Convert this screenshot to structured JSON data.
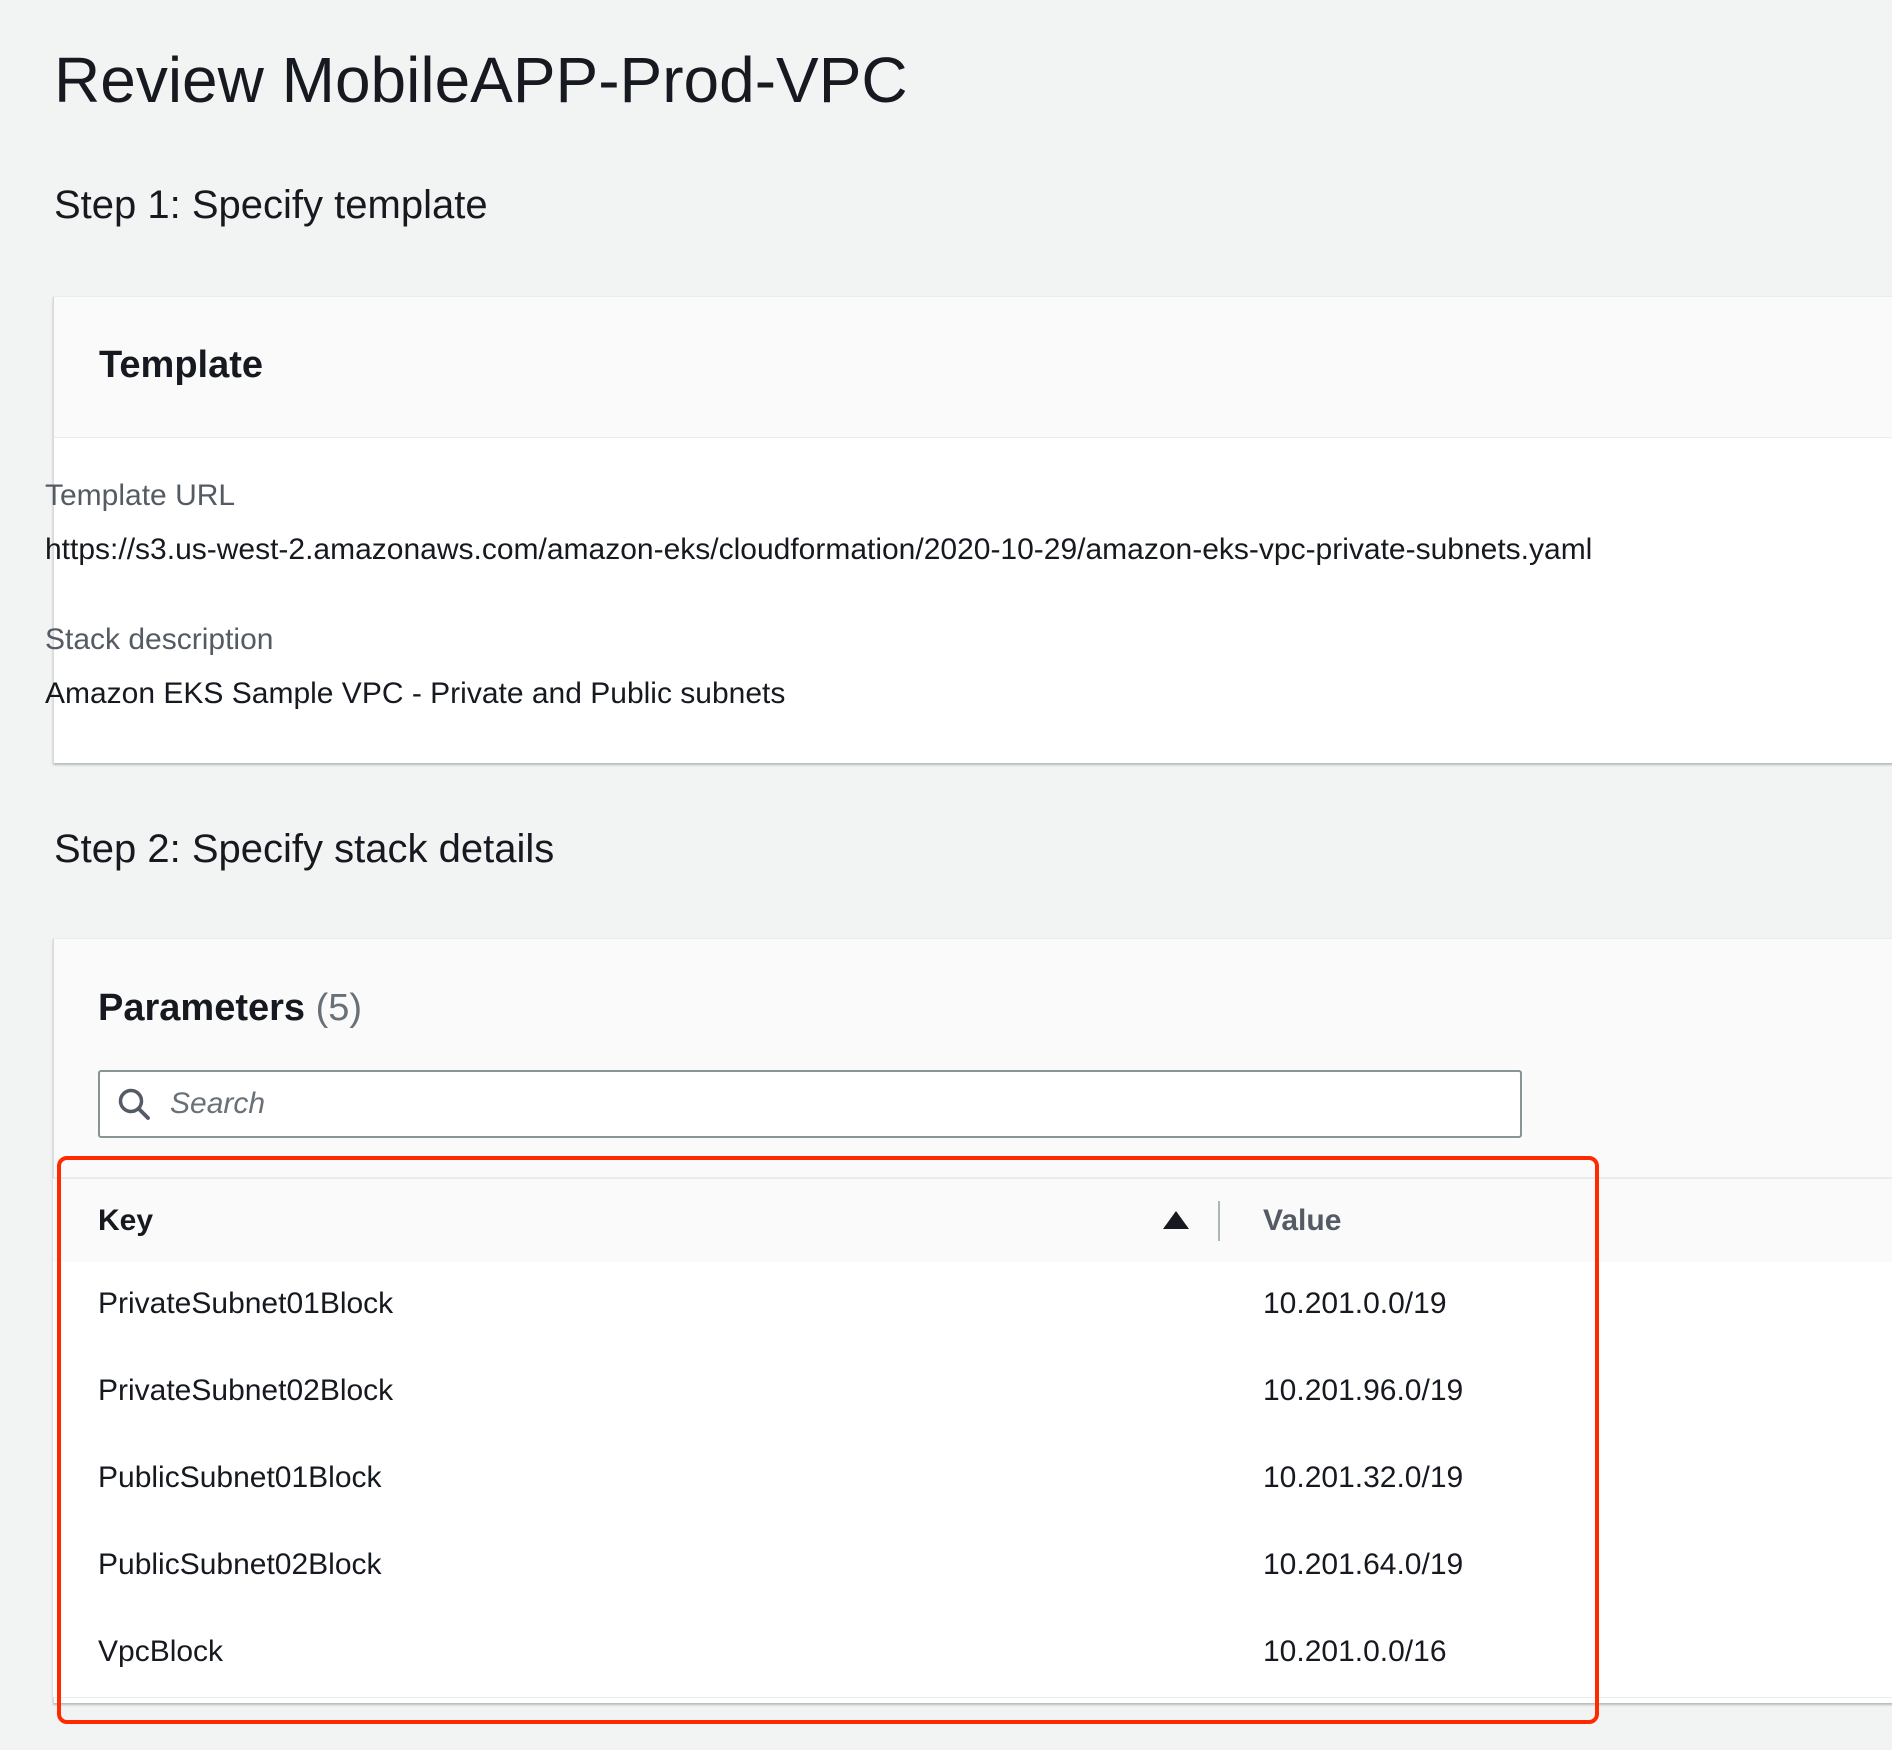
{
  "page": {
    "title": "Review MobileAPP-Prod-VPC"
  },
  "step1": {
    "heading": "Step 1: Specify template",
    "panel_title": "Template",
    "template_url_label": "Template URL",
    "template_url_value": "https://s3.us-west-2.amazonaws.com/amazon-eks/cloudformation/2020-10-29/amazon-eks-vpc-private-subnets.yaml",
    "stack_description_label": "Stack description",
    "stack_description_value": "Amazon EKS Sample VPC - Private and Public subnets"
  },
  "step2": {
    "heading": "Step 2: Specify stack details",
    "panel_title": "Parameters",
    "count": "(5)",
    "search": {
      "placeholder": "Search",
      "value": "",
      "icon": "search-icon"
    },
    "table": {
      "columns": {
        "key": "Key",
        "value": "Value"
      },
      "sort": {
        "column": "key",
        "direction": "ascending",
        "icon": "sort-ascending-icon"
      },
      "rows": [
        {
          "key": "PrivateSubnet01Block",
          "value": "10.201.0.0/19"
        },
        {
          "key": "PrivateSubnet02Block",
          "value": "10.201.96.0/19"
        },
        {
          "key": "PublicSubnet01Block",
          "value": "10.201.32.0/19"
        },
        {
          "key": "PublicSubnet02Block",
          "value": "10.201.64.0/19"
        },
        {
          "key": "VpcBlock",
          "value": "10.201.0.0/16"
        }
      ]
    }
  },
  "colors": {
    "background": "#f2f3f3",
    "panel": "#ffffff",
    "text": "#16191f",
    "secondary_text": "#545b64",
    "highlight_annotation": "#ff2a00"
  }
}
